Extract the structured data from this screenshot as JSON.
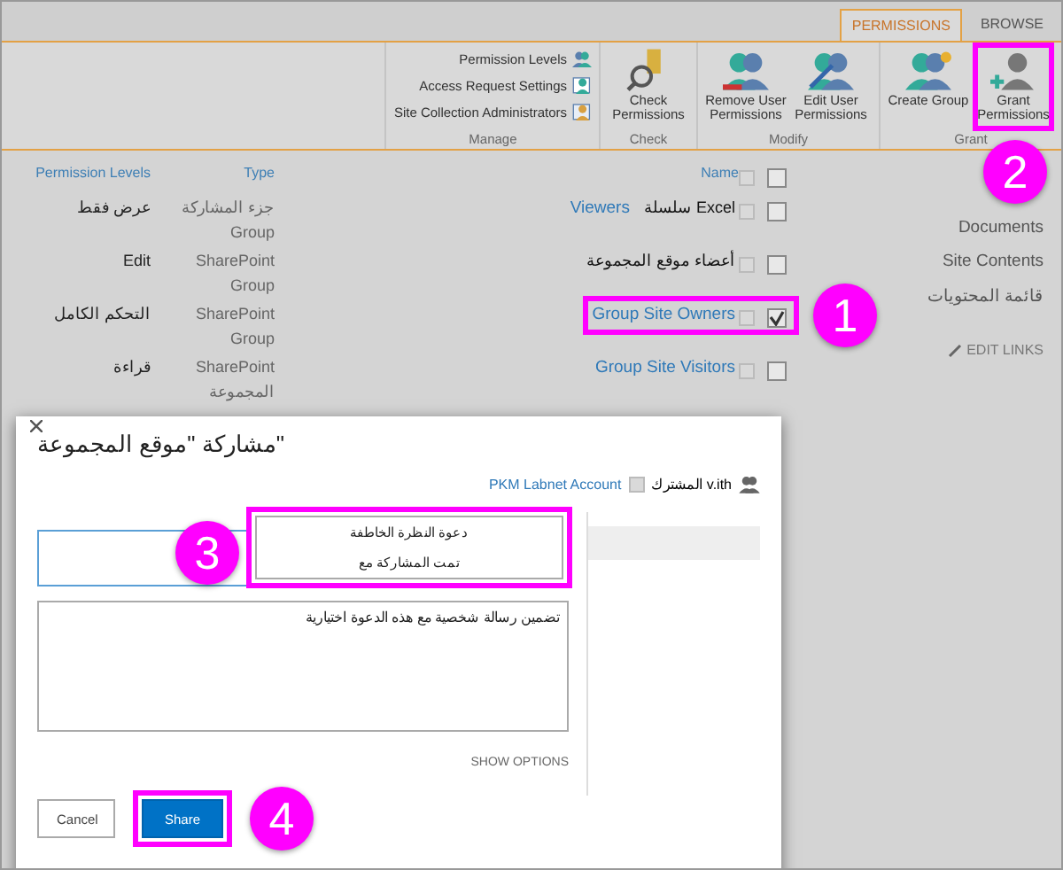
{
  "tabs": [
    {
      "label": "PERMISSIONS",
      "selected": true
    },
    {
      "label": "BROWSE",
      "selected": false
    }
  ],
  "ribbon_groups": [
    {
      "label": "Manage",
      "kind": "small",
      "buttons": [
        {
          "label": "Permission Levels"
        },
        {
          "label": "Access Request Settings"
        },
        {
          "label": "Site Collection Administrators"
        }
      ]
    },
    {
      "label": "Check",
      "kind": "large",
      "buttons": [
        {
          "label": "Check Permissions"
        }
      ]
    },
    {
      "label": "Modify",
      "kind": "large",
      "buttons": [
        {
          "label": "Remove User Permissions"
        },
        {
          "label": "Edit User Permissions"
        }
      ]
    },
    {
      "label": "Grant",
      "kind": "large",
      "buttons": [
        {
          "label": "Create Group"
        },
        {
          "label": "Grant Permissions",
          "callout": "2"
        }
      ]
    }
  ],
  "nav": [
    {
      "label": "Documents",
      "kind": "link"
    },
    {
      "label": "Site Contents",
      "kind": "link"
    },
    {
      "label": "قائمة المحتويات",
      "kind": "link"
    },
    {
      "label": "EDIT LINKS",
      "kind": "edit"
    }
  ],
  "table": {
    "columns": [
      "Permission Levels",
      "Type",
      "Name"
    ],
    "select_all_checked": false,
    "rows": [
      {
        "level": "عرض فقط",
        "type": [
          "جزء المشاركة",
          "Group"
        ],
        "name": "Viewers",
        "prefix": "سلسلة Excel",
        "checked": false
      },
      {
        "level": "Edit",
        "type": [
          "SharePoint",
          "Group"
        ],
        "prefix": "أعضاء موقع المجموعة",
        "checked": false
      },
      {
        "level": "التحكم الكامل",
        "type": [
          "SharePoint",
          "Group"
        ],
        "name": "Group Site Owners",
        "checked": true,
        "callout": "1"
      },
      {
        "level": "قراءة",
        "type": [
          "SharePoint",
          "المجموعة"
        ],
        "name": "Group Site Visitors",
        "checked": false
      }
    ]
  },
  "dialog": {
    "title": "مشاركة \"موقع المجموعة\"",
    "account": "PKM Labnet Account",
    "shared_by": "v.ith المشترك",
    "suggestions": [
      "دعوة النظرة الخاطفة",
      "تمت المشاركة مع"
    ],
    "suggestions_callout": "3",
    "message_placeholder": "تضمين رسالة شخصية مع هذه الدعوة اختيارية",
    "show_options": "SHOW OPTIONS",
    "buttons": [
      {
        "label": "Cancel",
        "kind": "secondary"
      },
      {
        "label": "Share",
        "kind": "primary",
        "callout": "4"
      }
    ]
  }
}
